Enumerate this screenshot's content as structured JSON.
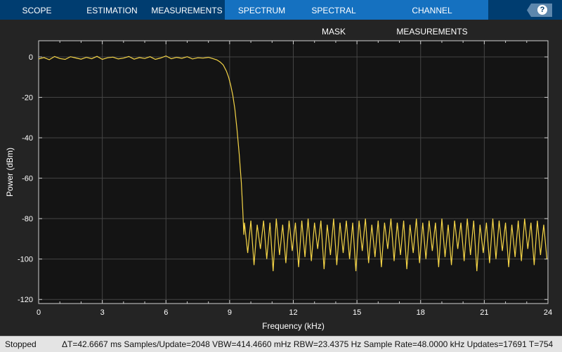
{
  "toolbar": {
    "tabs": [
      "SCOPE",
      "ESTIMATION",
      "MEASUREMENTS",
      "SPECTRUM",
      "SPECTRAL MASK",
      "CHANNEL MEASUREMENTS"
    ],
    "help_label": "?"
  },
  "status": {
    "state": "Stopped",
    "info": "ΔT=42.6667 ms  Samples/Update=2048  VBW=414.4660 mHz  RBW=23.4375 Hz  Sample Rate=48.0000 kHz  Updates=17691  T=754"
  },
  "chart_data": {
    "type": "line",
    "title": "",
    "xlabel": "Frequency (kHz)",
    "ylabel": "Power (dBm)",
    "xlim": [
      0,
      24
    ],
    "ylim": [
      -122,
      8
    ],
    "xticks": [
      0,
      3,
      6,
      9,
      12,
      15,
      18,
      21,
      24
    ],
    "yticks": [
      0,
      -20,
      -40,
      -60,
      -80,
      -100,
      -120
    ],
    "grid": true,
    "line_color": "#f5d547",
    "passband": {
      "x": [
        0,
        0.25,
        0.5,
        0.75,
        1,
        1.25,
        1.5,
        1.75,
        2,
        2.25,
        2.5,
        2.75,
        3,
        3.25,
        3.5,
        3.75,
        4,
        4.25,
        4.5,
        4.75,
        5,
        5.25,
        5.5,
        5.75,
        6,
        6.25,
        6.5,
        6.75,
        7,
        7.25,
        7.5,
        7.75,
        8,
        8.2,
        8.4,
        8.55,
        8.7,
        8.85,
        8.95,
        9.05,
        9.15,
        9.25,
        9.35,
        9.45,
        9.55,
        9.62,
        9.67
      ],
      "y": [
        -1,
        -0.3,
        -1.4,
        0.2,
        -0.8,
        -1.2,
        0.1,
        -0.5,
        -1.1,
        -0.2,
        -0.9,
        0.3,
        -1.2,
        -0.4,
        -0.1,
        -1,
        -0.6,
        0.2,
        -1.1,
        -0.3,
        -0.8,
        0.1,
        -1.2,
        -0.5,
        0.5,
        -0.9,
        -0.2,
        -0.7,
        0.1,
        -1,
        -0.4,
        -0.6,
        -0.2,
        -0.8,
        -1.5,
        -2.5,
        -4,
        -7,
        -10,
        -14,
        -19,
        -26,
        -36,
        -48,
        -62,
        -76,
        -88
      ]
    },
    "stopband": {
      "x_start": 9.7,
      "x_step": 0.15,
      "y": [
        -82,
        -97,
        -81,
        -103,
        -83,
        -95,
        -81,
        -100,
        -82,
        -106,
        -80,
        -98,
        -83,
        -102,
        -81,
        -96,
        -82,
        -104,
        -81,
        -99,
        -80,
        -101,
        -82,
        -95,
        -81,
        -105,
        -83,
        -98,
        -80,
        -103,
        -82,
        -97,
        -81,
        -100,
        -82,
        -106,
        -81,
        -96,
        -80,
        -102,
        -83,
        -99,
        -81,
        -104,
        -82,
        -95,
        -80,
        -101,
        -82,
        -98,
        -81,
        -105,
        -83,
        -97,
        -80,
        -102,
        -82,
        -100,
        -81,
        -96,
        -82,
        -104,
        -80,
        -99,
        -83,
        -103,
        -81,
        -95,
        -82,
        -101,
        -80,
        -98,
        -81,
        -106,
        -83,
        -97,
        -82,
        -102,
        -80,
        -100,
        -81,
        -96,
        -82,
        -104,
        -83,
        -99,
        -81,
        -101,
        -80,
        -95,
        -82,
        -103,
        -81,
        -98,
        -83,
        -100,
        -80
      ]
    }
  }
}
